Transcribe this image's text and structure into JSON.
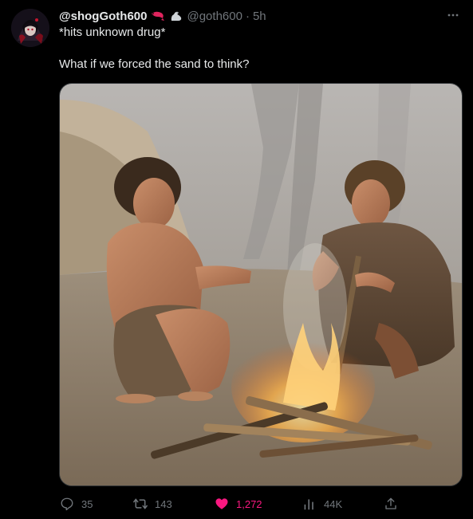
{
  "tweet": {
    "display_name": "@shogGoth600",
    "handle": "@goth600",
    "separator": "·",
    "time": "5h",
    "text_line1": "*hits unknown drug*",
    "text_line2": "What if we forced the sand to think?"
  },
  "image": {
    "description_icon": "image-photo"
  },
  "actions": {
    "replies": "35",
    "reposts": "143",
    "likes": "1,272",
    "views": "44K"
  },
  "colors": {
    "background": "#000000",
    "text": "#e7e9ea",
    "muted": "#71767b",
    "like_pink": "#f91880"
  }
}
